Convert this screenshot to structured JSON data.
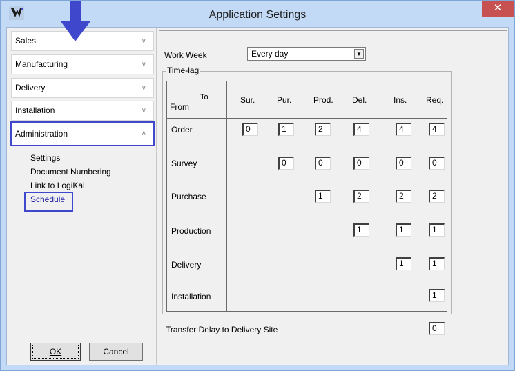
{
  "window": {
    "title": "Application Settings",
    "close_glyph": "✕"
  },
  "nav": {
    "headers": [
      {
        "label": "Sales",
        "expanded": false
      },
      {
        "label": "Manufacturing",
        "expanded": false
      },
      {
        "label": "Delivery",
        "expanded": false
      },
      {
        "label": "Installation",
        "expanded": false
      },
      {
        "label": "Administration",
        "expanded": true
      }
    ],
    "sub_items": [
      {
        "label": "Settings"
      },
      {
        "label": "Document Numbering"
      },
      {
        "label": "Link to LogiKal"
      },
      {
        "label": "Schedule"
      }
    ]
  },
  "buttons": {
    "ok": "OK",
    "cancel": "Cancel"
  },
  "settings": {
    "work_week_label": "Work Week",
    "work_week_value": "Every day",
    "time_lag_label": "Time-lag",
    "to_label": "To",
    "from_label": "From",
    "columns": [
      "Sur.",
      "Pur.",
      "Prod.",
      "Del.",
      "Ins.",
      "Req."
    ],
    "rows": [
      {
        "label": "Order",
        "values": [
          "0",
          "1",
          "2",
          "4",
          "4",
          "4"
        ]
      },
      {
        "label": "Survey",
        "values": [
          "",
          "0",
          "0",
          "0",
          "0",
          "0"
        ]
      },
      {
        "label": "Purchase",
        "values": [
          "",
          "",
          "1",
          "2",
          "2",
          "2"
        ]
      },
      {
        "label": "Production",
        "values": [
          "",
          "",
          "",
          "1",
          "1",
          "1"
        ]
      },
      {
        "label": "Delivery",
        "values": [
          "",
          "",
          "",
          "",
          "1",
          "1"
        ]
      },
      {
        "label": "Installation",
        "values": [
          "",
          "",
          "",
          "",
          "",
          "1"
        ]
      }
    ],
    "transfer_label": "Transfer Delay to Delivery Site",
    "transfer_value": "0"
  },
  "colors": {
    "highlight": "#3f48cc",
    "titlebar": "#c3daf6",
    "close": "#c75050",
    "annotation_arrow": "#3f48cc"
  }
}
